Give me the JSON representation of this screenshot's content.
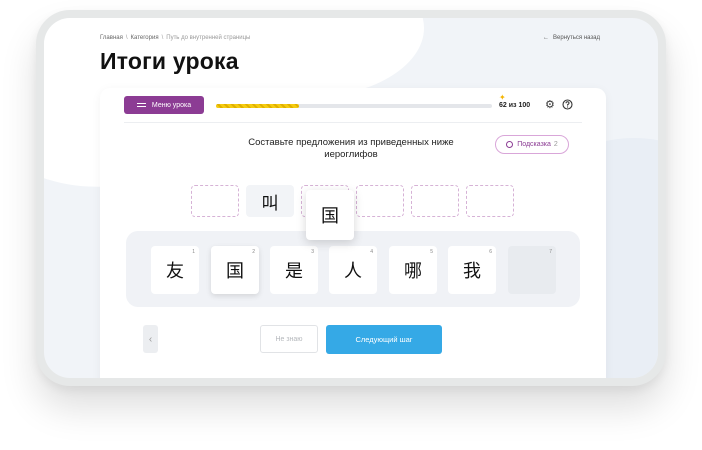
{
  "breadcrumb": [
    "Главная",
    "Категория",
    "Путь до внутренней страницы"
  ],
  "back_link": "Вернуться назад",
  "page_title": "Итоги урока",
  "toolbar": {
    "menu_label": "Меню урока",
    "progress_fraction": 0.3,
    "score": "62 из 100"
  },
  "icons": {
    "menu": "hamburger-icon",
    "star": "star-icon",
    "settings": "gear-icon",
    "help": "help-circle-icon",
    "hint": "lightbulb-icon",
    "prev": "chevron-left-icon"
  },
  "task": {
    "instruction": "Составьте предложения из приведенных ниже иероглифов",
    "hint_label": "Подсказка",
    "hint_count": "2"
  },
  "answer_slots": [
    "",
    "叫",
    "",
    "",
    "",
    ""
  ],
  "dragging_char": "国",
  "tiles": [
    {
      "char": "友",
      "num": "1"
    },
    {
      "char": "国",
      "num": "2"
    },
    {
      "char": "是",
      "num": "3"
    },
    {
      "char": "人",
      "num": "4"
    },
    {
      "char": "哪",
      "num": "5"
    },
    {
      "char": "我",
      "num": "6"
    },
    {
      "char": "",
      "num": "7"
    }
  ],
  "buttons": {
    "dont_know": "Не знаю",
    "next_step": "Следующий шаг"
  },
  "colors": {
    "accent": "#8c3c94",
    "primary": "#35a9e6",
    "progress": "#f5cc10"
  }
}
